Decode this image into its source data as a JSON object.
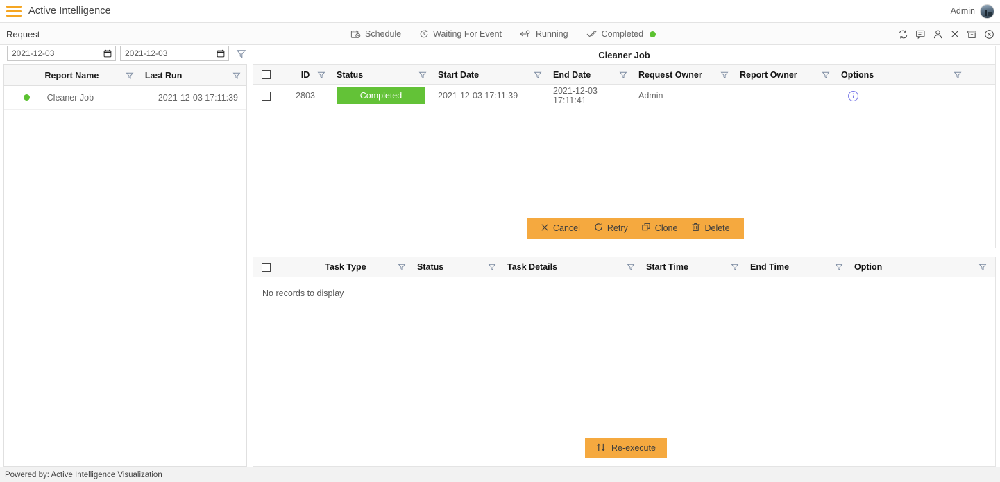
{
  "topbar": {
    "menu_icon": "hamburger-icon",
    "app_title": "Active Intelligence",
    "user_label": "Admin",
    "avatar_icon": "user-avatar"
  },
  "toolbar": {
    "section_label": "Request",
    "status_tabs": [
      {
        "label": "Schedule",
        "icon": "calendar-clock-icon",
        "active": false
      },
      {
        "label": "Waiting For Event",
        "icon": "clock-icon",
        "active": false
      },
      {
        "label": "Running",
        "icon": "arrow-pin-icon",
        "active": false
      },
      {
        "label": "Completed",
        "icon": "double-check-icon",
        "active": true
      }
    ],
    "icons": [
      "refresh-icon",
      "comment-icon",
      "person-icon",
      "close-icon",
      "archive-icon",
      "circle-x-icon"
    ]
  },
  "left_panel": {
    "date_from": "2021-12-03",
    "date_to": "2021-12-03",
    "date_icon": "calendar-icon",
    "filter_icon": "funnel-icon",
    "columns": [
      "Report Name",
      "Last Run"
    ],
    "rows": [
      {
        "status_color": "#5cc231",
        "report_name": "Cleaner Job",
        "last_run": "2021-12-03 17:11:39"
      }
    ]
  },
  "request_panel": {
    "title": "Cleaner Job",
    "columns": [
      "ID",
      "Status",
      "Start Date",
      "End Date",
      "Request Owner",
      "Report Owner",
      "Options"
    ],
    "rows": [
      {
        "id": "2803",
        "status": "Completed",
        "start_date": "2021-12-03 17:11:39",
        "end_date": "2021-12-03 17:11:41",
        "request_owner": "Admin",
        "report_owner": "",
        "option_icon": "info-icon"
      }
    ],
    "actions": [
      {
        "label": "Cancel",
        "icon": "x-icon"
      },
      {
        "label": "Retry",
        "icon": "refresh-cw-icon"
      },
      {
        "label": "Clone",
        "icon": "copy-icon"
      },
      {
        "label": "Delete",
        "icon": "trash-icon"
      }
    ]
  },
  "task_panel": {
    "columns": [
      "Task Type",
      "Status",
      "Task Details",
      "Start Time",
      "End Time",
      "Option"
    ],
    "empty_message": "No records to display",
    "action": {
      "label": "Re-execute",
      "icon": "reexecute-icon"
    }
  },
  "footer": {
    "powered_by": "Powered by: Active Intelligence Visualization"
  },
  "colors": {
    "accent_orange": "#f5a93f",
    "hamburger_orange": "#f5a623",
    "status_green": "#63c237",
    "dot_green": "#5cc231",
    "info_blue": "#6a6ae0"
  }
}
